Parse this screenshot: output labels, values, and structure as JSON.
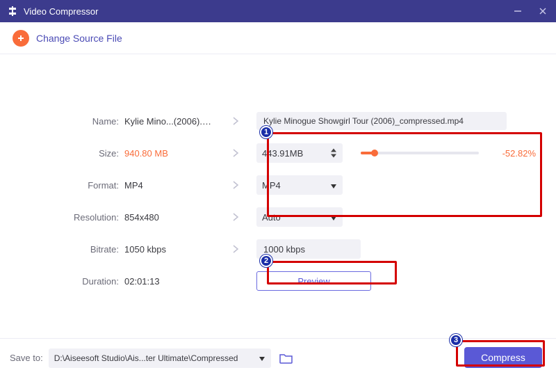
{
  "window": {
    "title": "Video Compressor"
  },
  "header": {
    "change_source_label": "Change Source File"
  },
  "labels": {
    "name": "Name:",
    "size": "Size:",
    "format": "Format:",
    "resolution": "Resolution:",
    "bitrate": "Bitrate:",
    "duration": "Duration:"
  },
  "source": {
    "name": "Kylie Mino...(2006).mp4",
    "size": "940.80 MB",
    "format": "MP4",
    "resolution": "854x480",
    "bitrate": "1050 kbps",
    "duration": "02:01:13"
  },
  "output": {
    "name": "Kylie Minogue Showgirl Tour (2006)_compressed.mp4",
    "size": "443.91MB",
    "size_reduction": "-52.82%",
    "size_slider_pct": 12,
    "format": "MP4",
    "resolution": "Auto",
    "bitrate": "1000 kbps"
  },
  "buttons": {
    "preview": "Preview",
    "compress": "Compress"
  },
  "footer": {
    "saveto_label": "Save to:",
    "saveto_path": "D:\\Aiseesoft Studio\\Ais...ter Ultimate\\Compressed"
  },
  "badges": {
    "one": "1",
    "two": "2",
    "three": "3"
  }
}
